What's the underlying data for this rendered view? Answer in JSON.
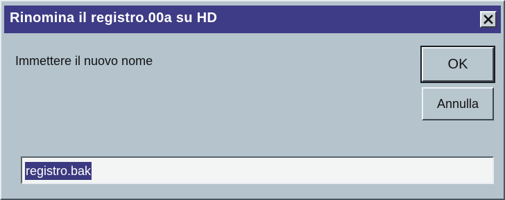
{
  "window": {
    "title": "Rinomina il registro.00a su HD",
    "close_icon": "close-icon",
    "title_bar_color": "#3e3c86"
  },
  "prompt": {
    "label": "Immettere il nuovo nome"
  },
  "buttons": {
    "ok_label": "OK",
    "cancel_label": "Annulla"
  },
  "input": {
    "value": "registro.bak",
    "selection_color": "#3b3a80"
  }
}
